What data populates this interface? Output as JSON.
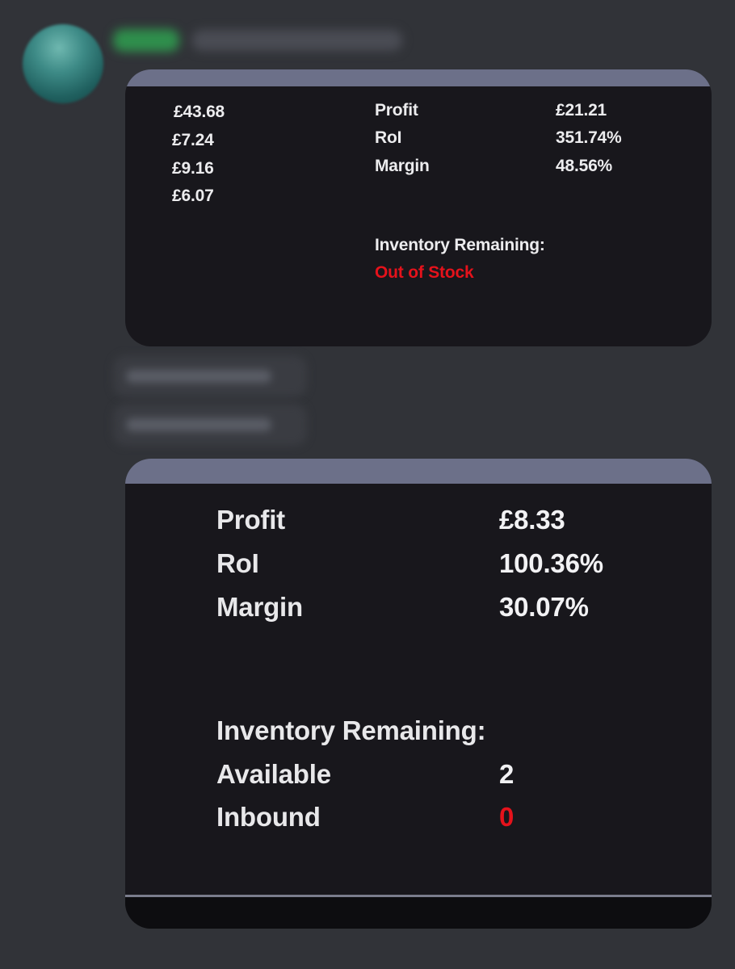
{
  "message_1": {
    "costs": [
      "£43.68",
      "£7.24",
      "£9.16",
      "£6.07"
    ],
    "metrics": [
      {
        "label": "Profit",
        "value": "£21.21"
      },
      {
        "label": "RoI",
        "value": "351.74%"
      },
      {
        "label": "Margin",
        "value": "48.56%"
      }
    ],
    "inventory_label": "Inventory Remaining:",
    "inventory_status": "Out of Stock"
  },
  "message_2": {
    "metrics": [
      {
        "label": "Profit",
        "value": "£8.33"
      },
      {
        "label": "RoI",
        "value": "100.36%"
      },
      {
        "label": "Margin",
        "value": "30.07%"
      }
    ],
    "inventory_label": "Inventory Remaining:",
    "inventory": [
      {
        "label": "Available",
        "value": "2"
      },
      {
        "label": "Inbound",
        "value": "0"
      }
    ]
  },
  "colors": {
    "background": "#313338",
    "embed_background": "#18171c",
    "embed_accent": "#6c7089",
    "alert_red": "#e5121b"
  }
}
